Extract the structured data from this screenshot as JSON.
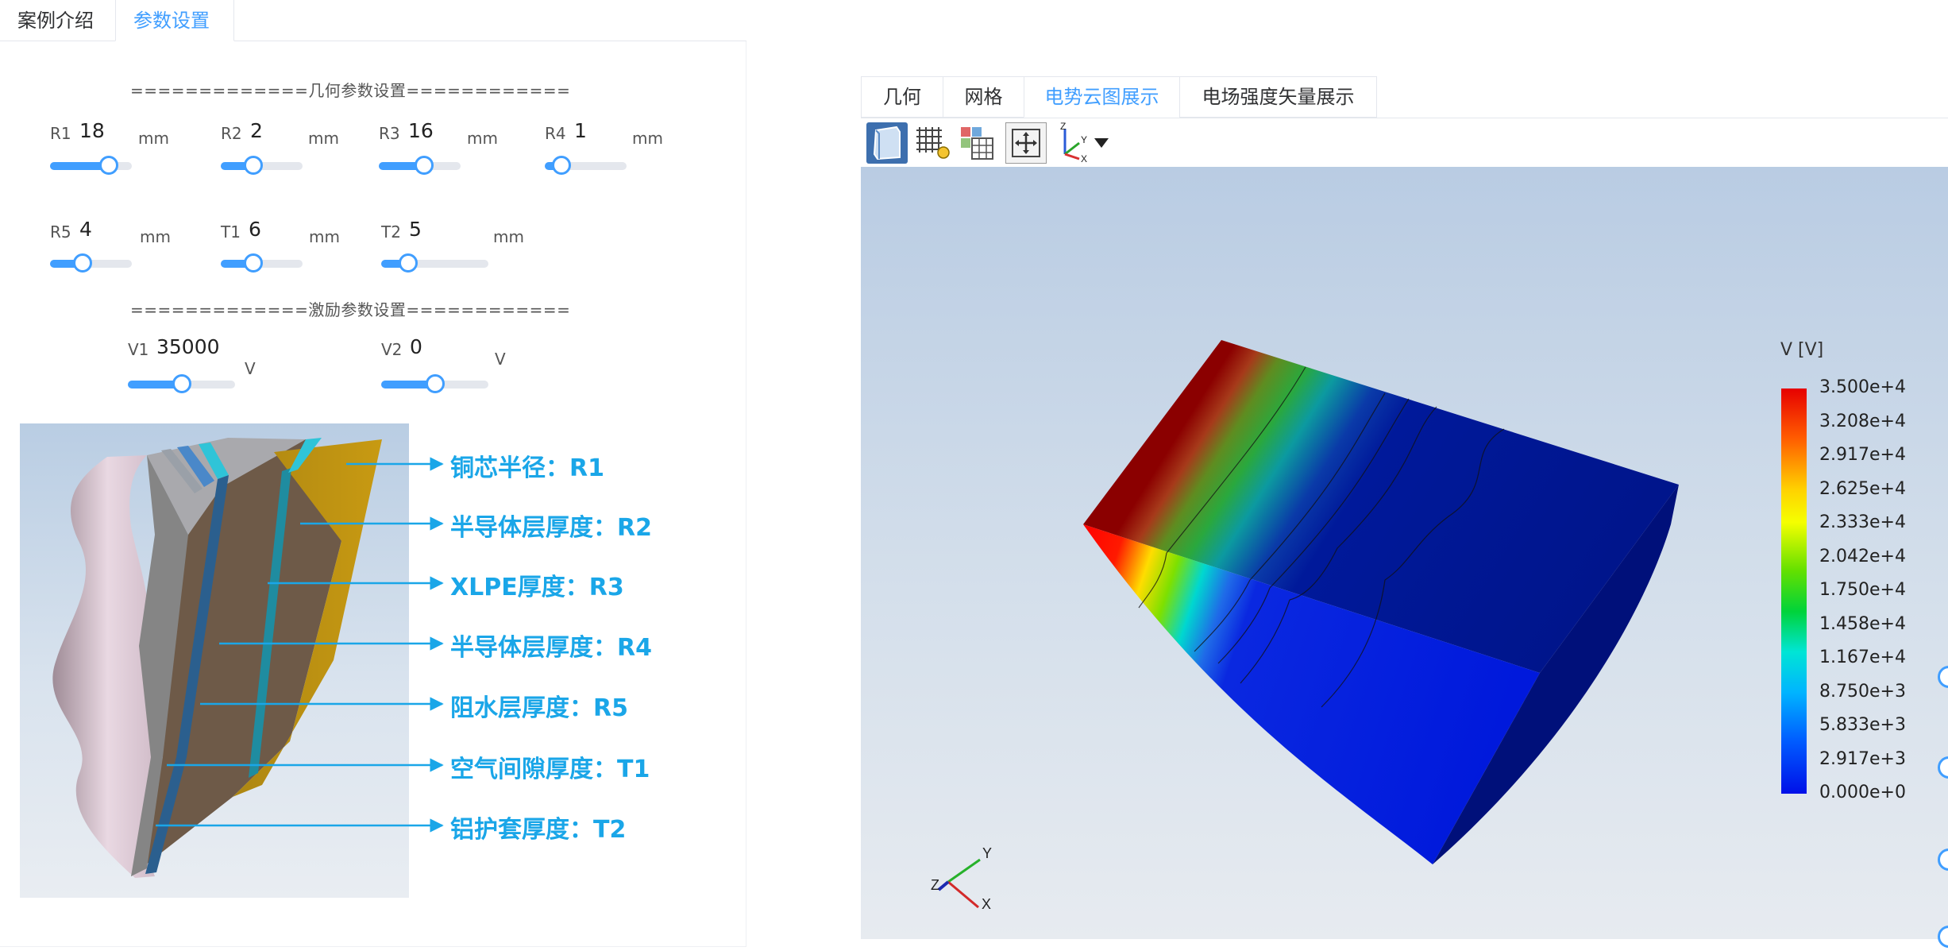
{
  "tabs": [
    {
      "label": "案例介绍"
    },
    {
      "label": "参数设置"
    }
  ],
  "geometry_section": {
    "title": "=============几何参数设置============"
  },
  "excitation_section": {
    "title": "=============激励参数设置============"
  },
  "params": {
    "R1": {
      "label": "R1",
      "value": "18",
      "unit": "mm",
      "slider_fraction": 0.72
    },
    "R2": {
      "label": "R2",
      "value": "2",
      "unit": "mm",
      "slider_fraction": 0.4
    },
    "R3": {
      "label": "R3",
      "value": "16",
      "unit": "mm",
      "slider_fraction": 0.55
    },
    "R4": {
      "label": "R4",
      "value": "1",
      "unit": "mm",
      "slider_fraction": 0.2
    },
    "R5": {
      "label": "R5",
      "value": "4",
      "unit": "mm",
      "slider_fraction": 0.4
    },
    "T1": {
      "label": "T1",
      "value": "6",
      "unit": "mm",
      "slider_fraction": 0.4
    },
    "T2": {
      "label": "T2",
      "value": "5",
      "unit": "mm",
      "slider_fraction": 0.25
    },
    "V1": {
      "label": "V1",
      "value": "35000",
      "unit": "V",
      "slider_fraction": 0.5
    },
    "V2": {
      "label": "V2",
      "value": "0",
      "unit": "V",
      "slider_fraction": 0.5
    }
  },
  "cable_callouts": [
    "铜芯半径：R1",
    "半导体层厚度：R2",
    "XLPE厚度：R3",
    "半导体层厚度：R4",
    "阻水层厚度：R5",
    "空气间隙厚度：T1",
    "铝护套厚度：T2"
  ],
  "viewer_tabs": [
    {
      "label": "几何"
    },
    {
      "label": "网格"
    },
    {
      "label": "电势云图展示"
    },
    {
      "label": "电场强度矢量展示"
    }
  ],
  "toolbar_icons": [
    "solid-view-icon",
    "mesh-view-icon",
    "grid-view-icon",
    "fit-view-icon",
    "axes-orientation-icon",
    "dropdown-arrow-icon"
  ],
  "legend": {
    "title": "V [V]",
    "ticks": [
      "3.500e+4",
      "3.208e+4",
      "2.917e+4",
      "2.625e+4",
      "2.333e+4",
      "2.042e+4",
      "1.750e+4",
      "1.458e+4",
      "1.167e+4",
      "8.750e+3",
      "5.833e+3",
      "2.917e+3",
      "0.000e+0"
    ]
  },
  "axes_triad": {
    "y": "Y",
    "x": "X",
    "z": "Z"
  },
  "toolbar_axes": {
    "z": "Z",
    "y": "Y",
    "x": "X"
  },
  "colors": {
    "accent": "#409eff",
    "callout": "#1aa6e8"
  }
}
